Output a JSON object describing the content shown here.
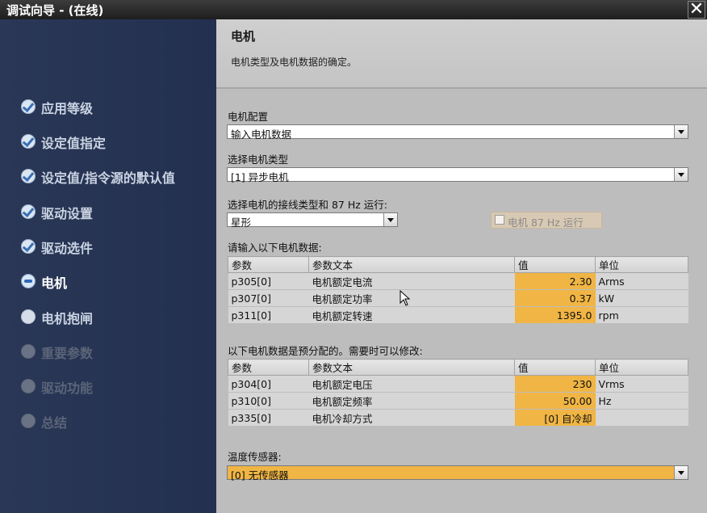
{
  "window": {
    "title": "调试向导 - (在线)",
    "close_symbol": "✕"
  },
  "sidebar": {
    "items": [
      {
        "label": "应用等级",
        "state": "done"
      },
      {
        "label": "设定值指定",
        "state": "done"
      },
      {
        "label": "设定值/指令源的默认值",
        "state": "done"
      },
      {
        "label": "驱动设置",
        "state": "done"
      },
      {
        "label": "驱动选件",
        "state": "done"
      },
      {
        "label": "电机",
        "state": "current"
      },
      {
        "label": "电机抱闸",
        "state": "pending"
      },
      {
        "label": "重要参数",
        "state": "disabled"
      },
      {
        "label": "驱动功能",
        "state": "disabled"
      },
      {
        "label": "总结",
        "state": "disabled"
      }
    ]
  },
  "header": {
    "title": "电机",
    "description": "电机类型及电机数据的确定。"
  },
  "motor_config": {
    "label": "电机配置",
    "value": "输入电机数据"
  },
  "motor_type": {
    "label": "选择电机类型",
    "value": "[1] 异步电机"
  },
  "wiring": {
    "label": "选择电机的接线类型和 87 Hz 运行:",
    "value": "星形",
    "checkbox_label": "电机 87 Hz 运行",
    "checked": false
  },
  "table1": {
    "caption": "请输入以下电机数据:",
    "headers": [
      "参数",
      "参数文本",
      "值",
      "单位"
    ],
    "rows": [
      [
        "p305[0]",
        "电机额定电流",
        "2.30",
        "Arms"
      ],
      [
        "p307[0]",
        "电机额定功率",
        "0.37",
        "kW"
      ],
      [
        "p311[0]",
        "电机额定转速",
        "1395.0",
        "rpm"
      ]
    ]
  },
  "table2": {
    "caption": "以下电机数据是预分配的。需要时可以修改:",
    "headers": [
      "参数",
      "参数文本",
      "值",
      "单位"
    ],
    "rows": [
      [
        "p304[0]",
        "电机额定电压",
        "230",
        "Vrms"
      ],
      [
        "p310[0]",
        "电机额定频率",
        "50.00",
        "Hz"
      ],
      [
        "p335[0]",
        "电机冷却方式",
        "[0] 自冷却",
        ""
      ]
    ]
  },
  "temp_sensor": {
    "label": "温度传感器:",
    "value": "[0] 无传感器"
  },
  "colors": {
    "sidebar_bg": "#2a3756",
    "content_bg": "#bdbdbd",
    "accent_orange": "#f0b544"
  }
}
